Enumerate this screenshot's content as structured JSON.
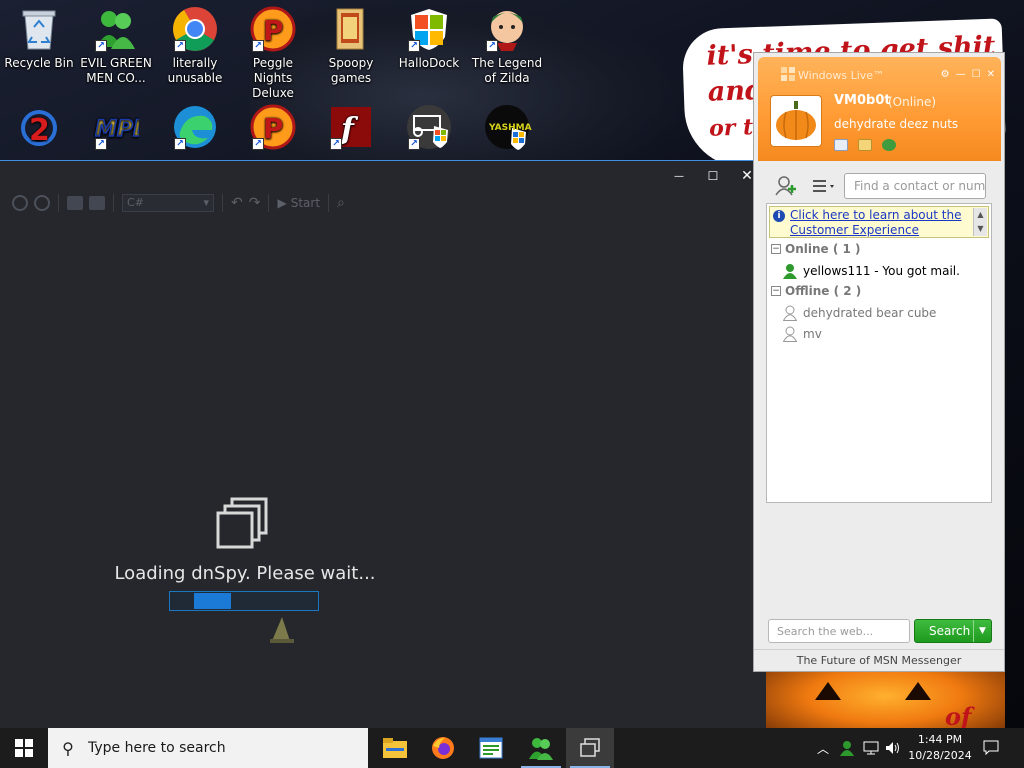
{
  "wallpaper": {
    "bubble_lines": [
      "it's time to get shit",
      "and",
      "or t"
    ],
    "pumpkin_text": "of"
  },
  "desktop": {
    "icons": [
      {
        "label": "Recycle Bin",
        "icon": "recycle-bin-icon"
      },
      {
        "label": "EVIL GREEN MEN CO...",
        "icon": "msn-buddies-icon"
      },
      {
        "label": "literally unusable",
        "icon": "chrome-icon"
      },
      {
        "label": "Peggle Nights Deluxe",
        "icon": "peggle-icon"
      },
      {
        "label": "Spoopy games",
        "icon": "folder-icon"
      },
      {
        "label": "HalloDock",
        "icon": "windows-shield-icon"
      },
      {
        "label": "The Legend of Zilda",
        "icon": "zilda-icon"
      },
      {
        "label": "",
        "icon": "game-2-icon"
      },
      {
        "label": "",
        "icon": "mpl-icon"
      },
      {
        "label": "",
        "icon": "edge-icon"
      },
      {
        "label": "",
        "icon": "peggle-icon"
      },
      {
        "label": "",
        "icon": "flash-icon"
      },
      {
        "label": "",
        "icon": "cart-shield-icon"
      },
      {
        "label": "",
        "icon": "yashma-icon"
      }
    ],
    "yashma_text": "YASHMA"
  },
  "dnspy": {
    "caption_buttons": {
      "minimize": "—",
      "maximize": "☐",
      "close": "✕"
    },
    "toolbar": {
      "language": "C#",
      "start": "Start"
    },
    "loading_text": "Loading dnSpy. Please wait...",
    "progress": 0.25
  },
  "msn": {
    "title": "Windows Live™",
    "display_name": "VM0b0t",
    "status": "(Online)",
    "personal_message": "dehydrate deez nuts",
    "find_placeholder": "Find a contact or number...",
    "info_link": "Click here to learn about the Customer Experience",
    "groups": [
      {
        "label": "Online ( 1 )",
        "contacts": [
          {
            "name": "yellows111 - You got mail.",
            "online": true
          }
        ]
      },
      {
        "label": "Offline ( 2 )",
        "contacts": [
          {
            "name": "dehydrated bear cube",
            "online": false
          },
          {
            "name": "mv",
            "online": false
          }
        ]
      }
    ],
    "search_placeholder": "Search the web...",
    "search_button": "Search",
    "footer": "The Future of MSN Messenger"
  },
  "taskbar": {
    "search_placeholder": "Type here to search",
    "time": "1:44 PM",
    "date": "10/28/2024",
    "apps": [
      "file-explorer-icon",
      "firefox-icon",
      "notepad-icon",
      "msn-messenger-icon",
      "task-view-icon"
    ]
  }
}
